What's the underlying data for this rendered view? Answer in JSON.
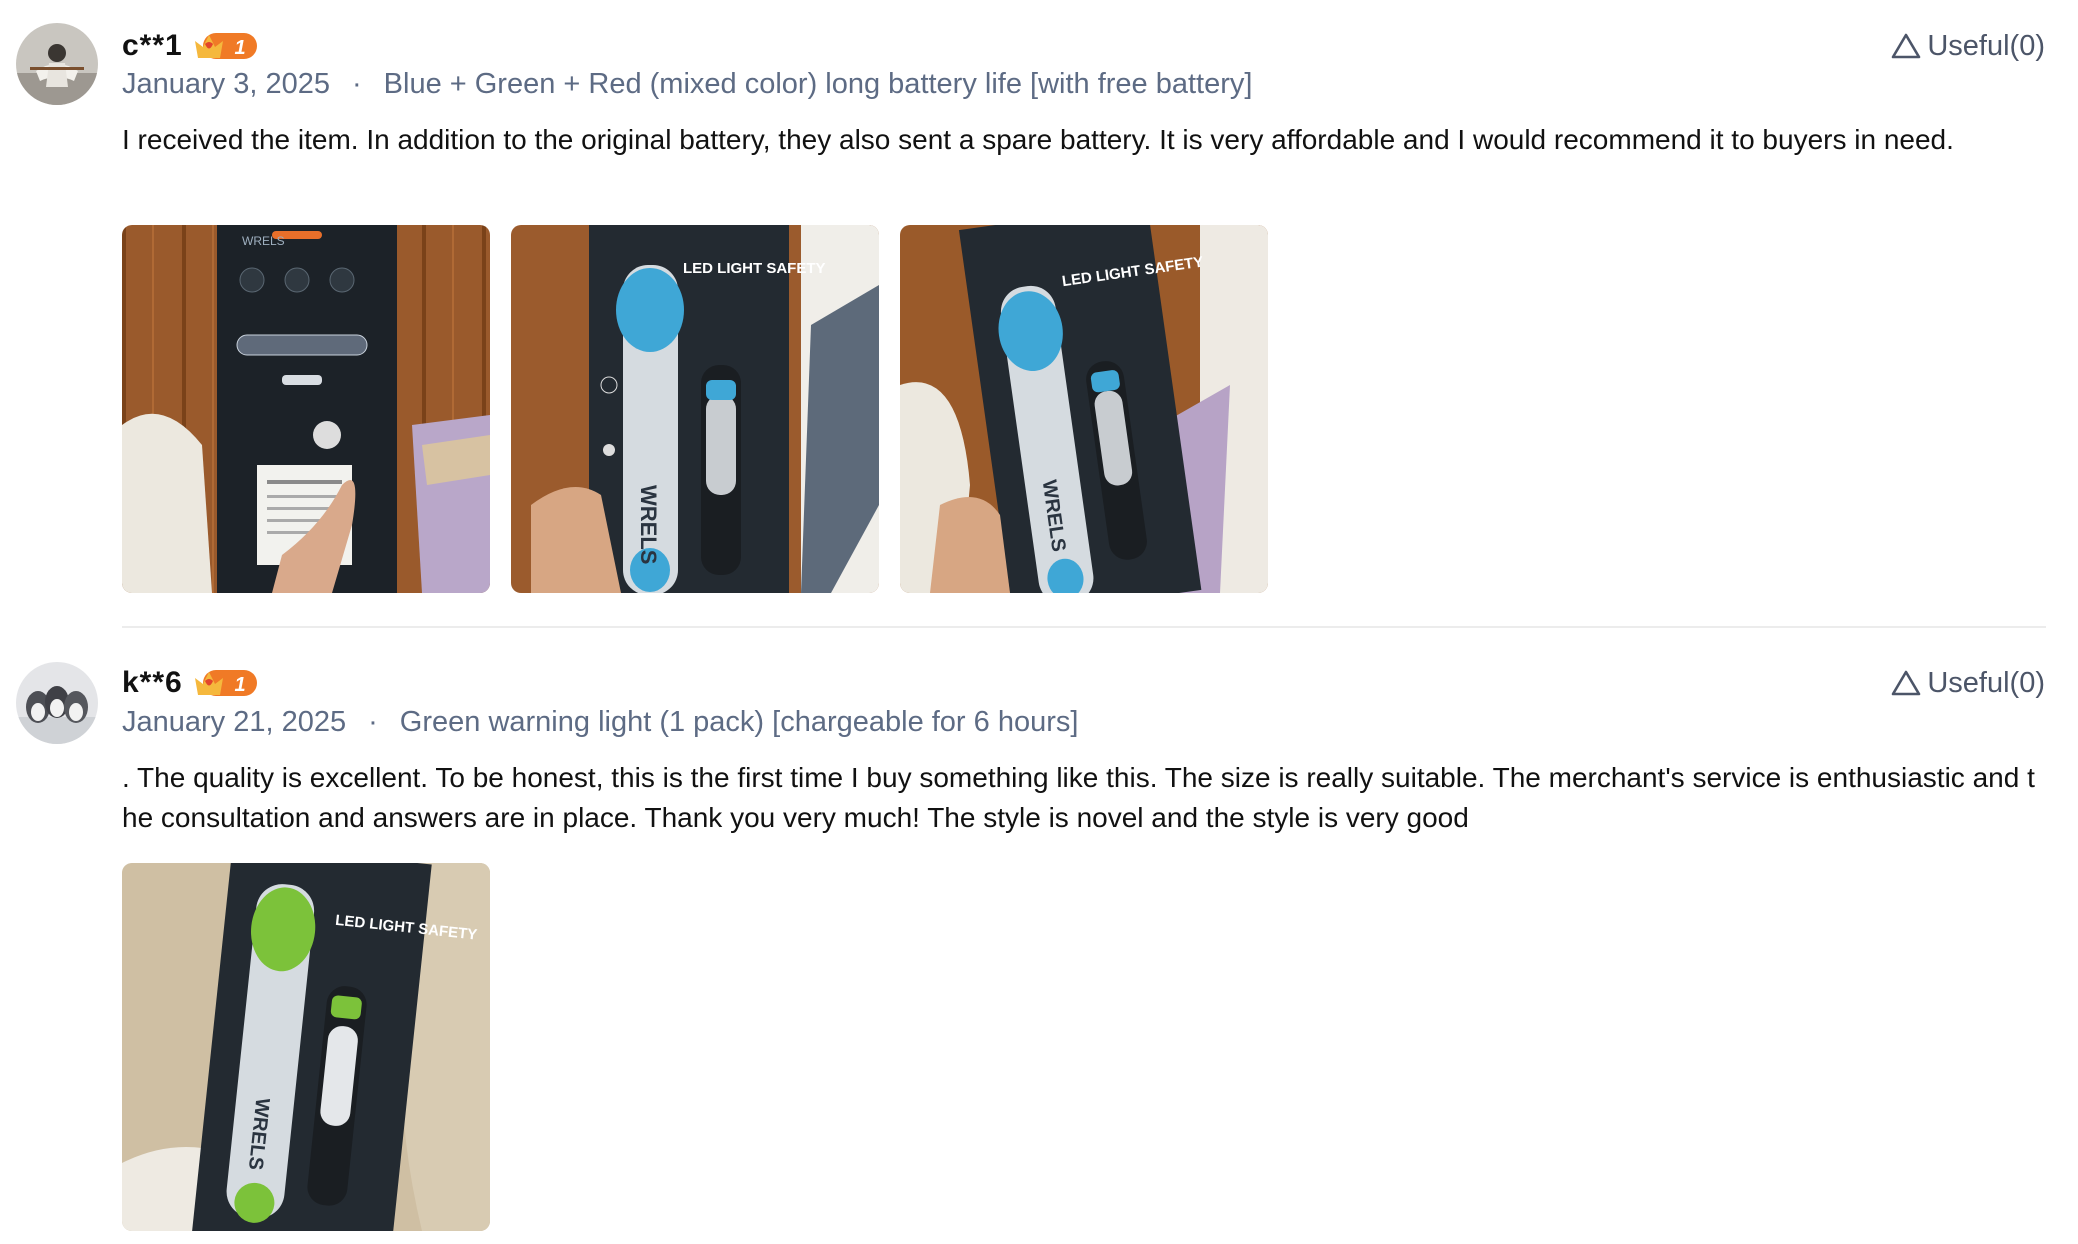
{
  "reviews": [
    {
      "username": "c**1",
      "badge_level": "1",
      "date": "January 3, 2025",
      "separator": "·",
      "variant": "Blue + Green + Red (mixed color) long battery life [with free battery]",
      "useful_label": "Useful(0)",
      "text": "I received the item. In addition to the original battery, they also sent a spare battery. It is very affordable and I would recommend it to buyers in need.",
      "photos": [
        {
          "kind": "back-of-package",
          "package_text": "WRELS"
        },
        {
          "kind": "front-blue",
          "package_text": "LED LIGHT SAFETY",
          "brand": "WRELS",
          "accent": "#3fa7d6"
        },
        {
          "kind": "front-blue",
          "package_text": "LED LIGHT SAFETY",
          "brand": "WRELS",
          "accent": "#3fa7d6"
        }
      ]
    },
    {
      "username": "k**6",
      "badge_level": "1",
      "date": "January 21, 2025",
      "separator": "·",
      "variant": "Green warning light (1 pack) [chargeable for 6 hours]",
      "useful_label": "Useful(0)",
      "text": ". The quality is excellent. To be honest, this is the first time I buy something like this. The size is really suitable. The merchant's service is enthusiastic and the consultation and answers are in place. Thank you very much! The style is novel and the style is very good",
      "photos": [
        {
          "kind": "front-green",
          "package_text": "LED LIGHT SAFETY",
          "brand": "WRELS",
          "accent": "#7cc23a"
        }
      ]
    }
  ],
  "icons": {
    "useful": "triangle-outline-icon",
    "badge": "crown-level-badge-icon"
  },
  "colors": {
    "meta_text": "#5d6b84",
    "useful_text": "#4c5568",
    "badge_orange": "#f07a26",
    "divider": "#ececec"
  }
}
